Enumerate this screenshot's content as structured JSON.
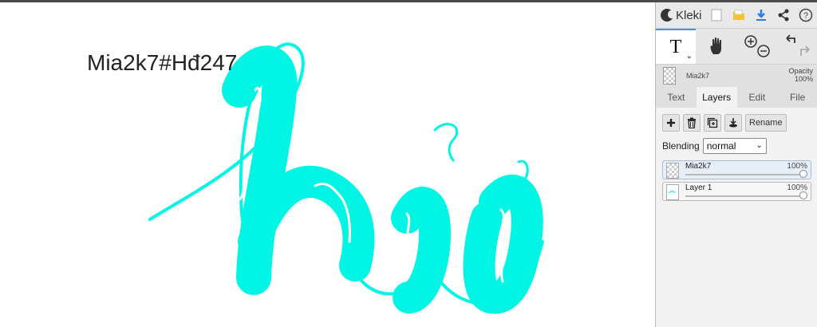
{
  "canvas": {
    "text": "Mia2k7#Hđ247",
    "drawing_color": "#00f5e4"
  },
  "app": {
    "name": "Kleki"
  },
  "toolbar": {
    "top_icons": [
      "new-image-icon",
      "open-folder-icon",
      "download-icon",
      "share-icon",
      "help-icon"
    ],
    "text_tool_label": "T"
  },
  "layer_preview": {
    "name": "Mia2k7",
    "opacity_label": "Opacity",
    "opacity_value": "100%"
  },
  "tabs": [
    {
      "label": "Text",
      "active": false
    },
    {
      "label": "Layers",
      "active": true
    },
    {
      "label": "Edit",
      "active": false
    },
    {
      "label": "File",
      "active": false
    }
  ],
  "layers_panel": {
    "rename_label": "Rename",
    "blending_label": "Blending",
    "blending_value": "normal",
    "layers": [
      {
        "name": "Mia2k7",
        "opacity": "100%",
        "opacity_fraction": 1.0,
        "selected": true
      },
      {
        "name": "Layer 1",
        "opacity": "100%",
        "opacity_fraction": 1.0,
        "selected": false
      }
    ]
  },
  "colors": {
    "accent": "#4a90d9",
    "download": "#2a7be4",
    "folder": "#f5b820",
    "sidebar_bg": "#e0e0e0"
  }
}
